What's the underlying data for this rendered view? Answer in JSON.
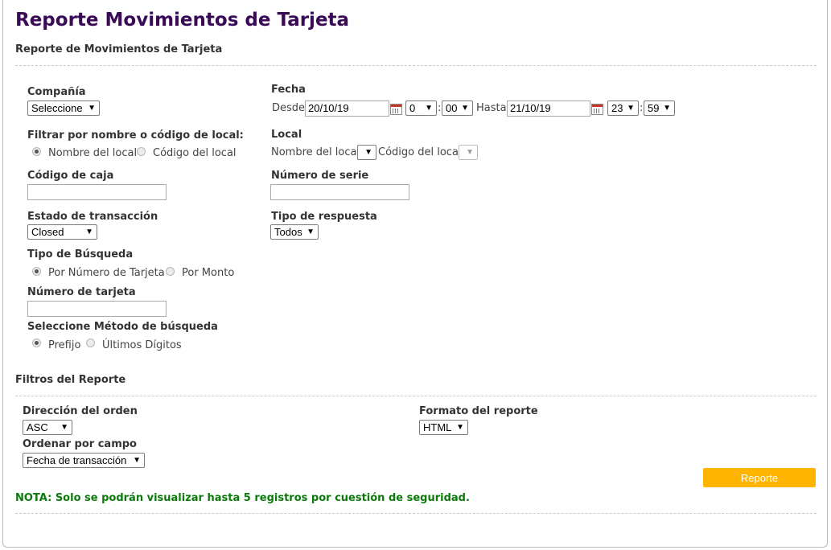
{
  "page": {
    "title": "Reporte Movimientos de Tarjeta",
    "section_title": "Reporte de Movimientos de Tarjeta"
  },
  "form": {
    "company": {
      "label": "Compañía",
      "value": "Seleccione"
    },
    "filter_local": {
      "label": "Filtrar por nombre o código de local:",
      "option1": "Nombre del local",
      "option2": "Código del local",
      "selected": "Nombre del local"
    },
    "cash_code": {
      "label": "Código de caja",
      "value": ""
    },
    "transaction_state": {
      "label": "Estado de transacción",
      "value": "Closed"
    },
    "search_type": {
      "label": "Tipo de Búsqueda",
      "option1": "Por Número de Tarjeta",
      "option2": "Por Monto",
      "selected": "Por Número de Tarjeta"
    },
    "card_number": {
      "label": "Número de tarjeta",
      "value": ""
    },
    "search_method": {
      "label": "Seleccione Método de búsqueda",
      "option1": "Prefijo",
      "option2": "Últimos Dígitos",
      "selected": "Prefijo"
    },
    "date": {
      "label": "Fecha",
      "from_label": "Desde",
      "from_date": "20/10/19",
      "from_hour": "0",
      "from_min": "00",
      "to_label": "Hasta",
      "to_date": "21/10/19",
      "to_hour": "23",
      "to_min": "59",
      "colon": ":"
    },
    "local": {
      "label": "Local",
      "name_label": "Nombre del local",
      "code_label": "Código del local"
    },
    "serial_number": {
      "label": "Número de serie",
      "value": ""
    },
    "response_type": {
      "label": "Tipo de respuesta",
      "value": "Todos"
    }
  },
  "filters": {
    "section_title": "Filtros del Reporte",
    "order_direction": {
      "label": "Dirección del orden",
      "value": "ASC"
    },
    "order_field": {
      "label": "Ordenar por campo",
      "value": "Fecha de transacción"
    },
    "report_format": {
      "label": "Formato del reporte",
      "value": "HTML"
    }
  },
  "actions": {
    "report_button": "Reporte"
  },
  "note": "NOTA: Solo se podrán visualizar hasta 5 registros por cuestión de seguridad.",
  "icons": {
    "dropdown": "chevron-down-icon",
    "calendar": "calendar-icon"
  },
  "colors": {
    "title": "#3a0a57",
    "button": "#ffb400",
    "note": "#0b7a0b"
  }
}
